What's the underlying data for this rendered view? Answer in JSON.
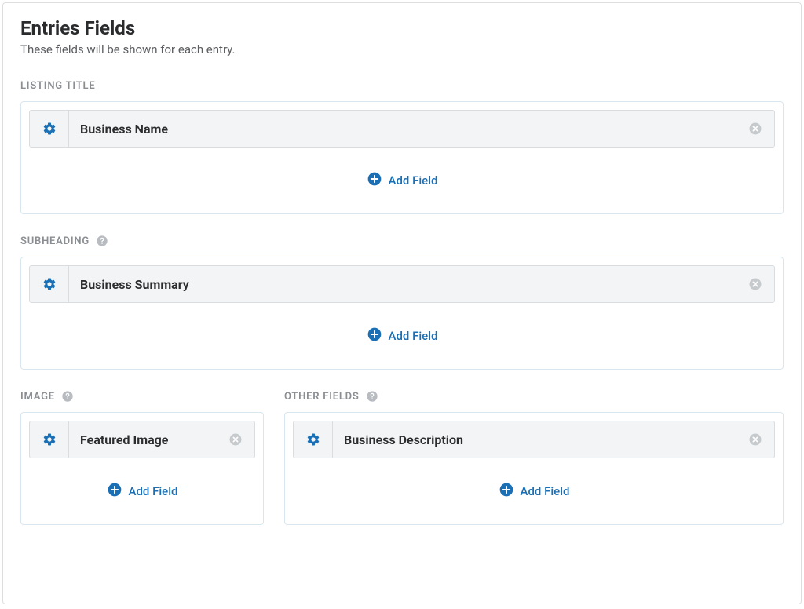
{
  "page": {
    "title": "Entries Fields",
    "subtitle": "These fields will be shown for each entry."
  },
  "add_field_label": "Add Field",
  "sections": {
    "listing_title": {
      "label": "LISTING TITLE",
      "field_name": "Business Name",
      "has_help": false
    },
    "subheading": {
      "label": "SUBHEADING",
      "field_name": "Business Summary",
      "has_help": true
    },
    "image": {
      "label": "IMAGE",
      "field_name": "Featured Image",
      "has_help": true
    },
    "other_fields": {
      "label": "OTHER FIELDS",
      "field_name": "Business Description",
      "has_help": true
    }
  }
}
